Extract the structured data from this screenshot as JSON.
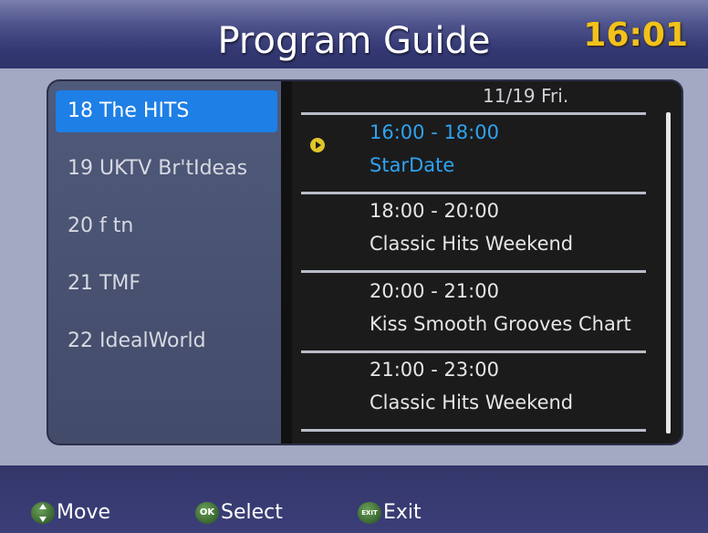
{
  "header": {
    "title": "Program Guide",
    "time": "16:01"
  },
  "channels": [
    {
      "label": "18 The HITS",
      "selected": true
    },
    {
      "label": "19 UKTV Br'tIdeas",
      "selected": false
    },
    {
      "label": "20 f tn",
      "selected": false
    },
    {
      "label": "21 TMF",
      "selected": false
    },
    {
      "label": "22 IdealWorld",
      "selected": false
    }
  ],
  "schedule": {
    "date": "11/19  Fri.",
    "programs": [
      {
        "time": "16:00 - 18:00",
        "name": "StarDate",
        "current": true
      },
      {
        "time": "18:00 - 20:00",
        "name": "Classic Hits Weekend",
        "current": false
      },
      {
        "time": "20:00 - 21:00",
        "name": "Kiss Smooth Grooves Chart",
        "current": false
      },
      {
        "time": "21:00 - 23:00",
        "name": "Classic Hits Weekend",
        "current": false
      }
    ]
  },
  "footer": {
    "move_label": "Move",
    "ok_icon_text": "OK",
    "select_label": "Select",
    "exit_icon_text": "EXIT",
    "exit_label": "Exit"
  },
  "colors": {
    "selected_bg": "#1e7fe6",
    "current_program": "#2ea3f2",
    "clock": "#f2c21a"
  },
  "icons": {
    "playing": "play-icon",
    "move": "move-icon",
    "ok": "ok-icon",
    "exit": "exit-icon"
  }
}
